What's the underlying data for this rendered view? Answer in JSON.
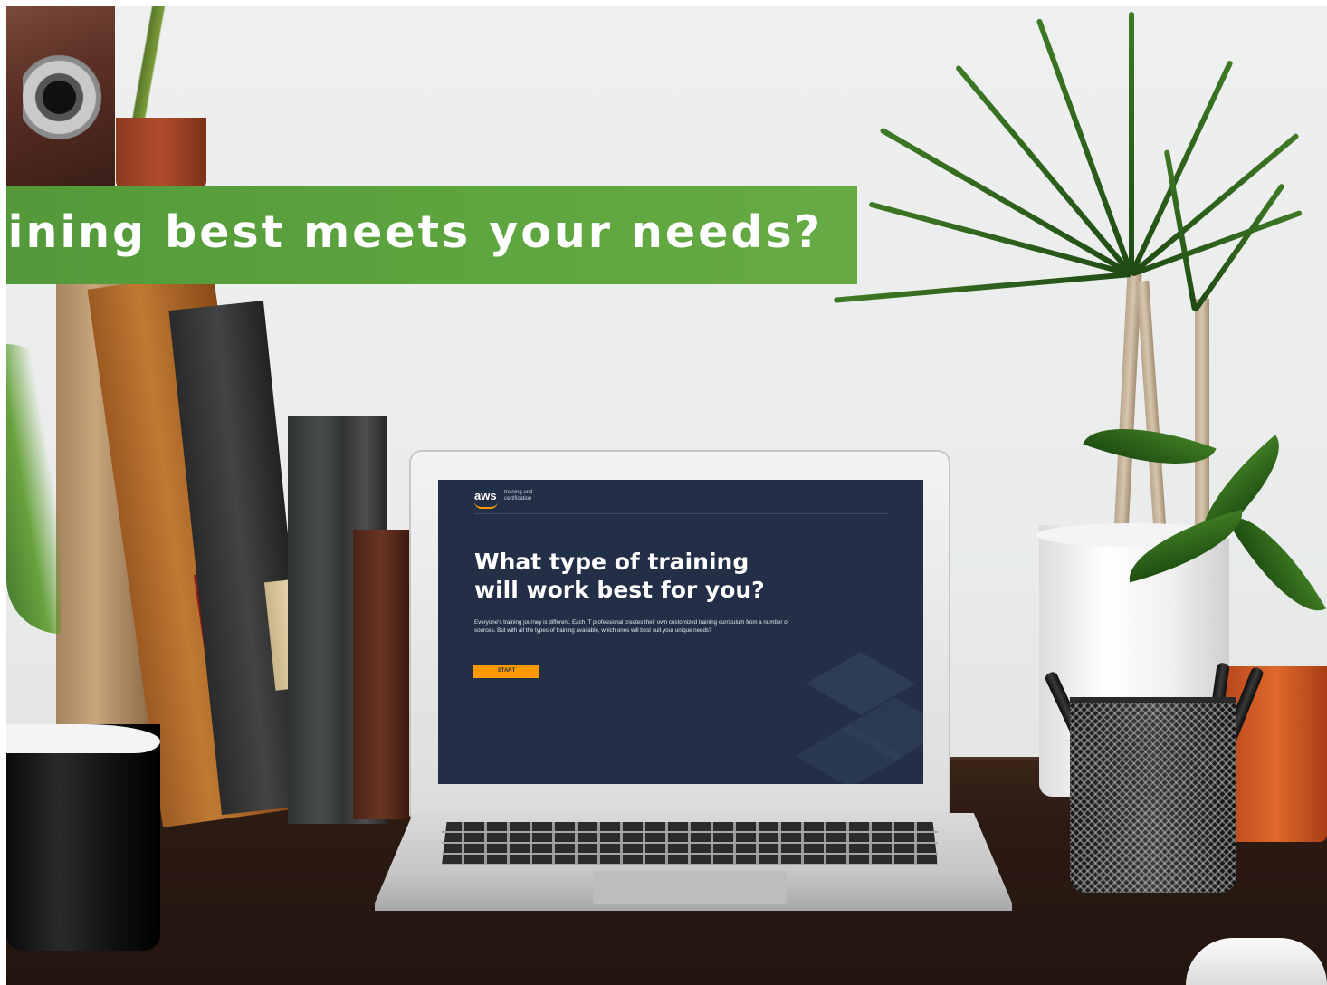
{
  "banner": {
    "text": "aining best meets your needs?",
    "color": "#5ea63f"
  },
  "screen": {
    "logo": "aws",
    "logo_subtitle": "training and certification",
    "heading": "What type of training will work best for you?",
    "body": "Everyone's training journey is different. Each IT professional creates their own customized training curriculum from a number of sources. But with all the types of training available, which ones will best suit your unique needs?",
    "start_label": "START",
    "background_color": "#232f47",
    "accent_color": "#ff9900"
  }
}
